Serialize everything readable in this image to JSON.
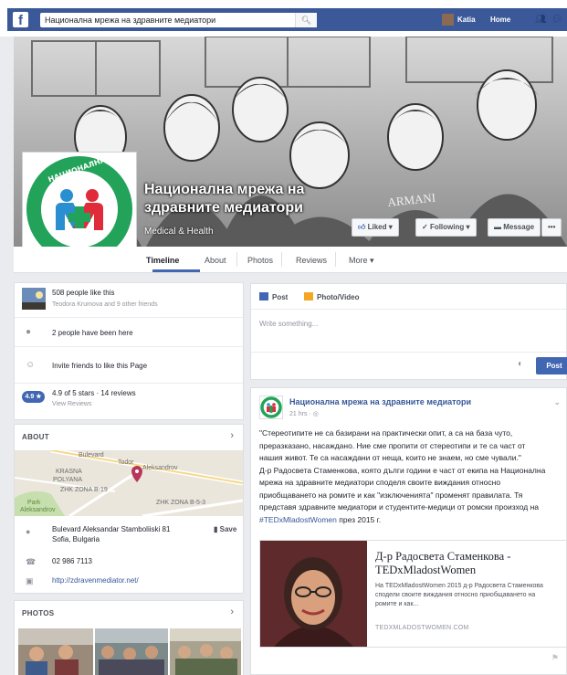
{
  "topbar": {
    "logo": "f",
    "search_value": "Национална мрежа на здравните медиатори",
    "user_name": "Katia",
    "home_label": "Home",
    "icons": [
      "search-icon",
      "friends-icon",
      "messages-icon"
    ]
  },
  "page": {
    "name": "Национална мрежа на здравните медиатори",
    "category": "Medical & Health",
    "buttons": {
      "liked": "Liked ▾",
      "following": "Following ▾",
      "message": "Message",
      "more": "•••"
    }
  },
  "tabs": [
    "Timeline",
    "About",
    "Photos",
    "Reviews",
    "More ▾"
  ],
  "likes_card": {
    "likes": "508 people like this",
    "likes_sub": "Teodora Krumova and 9 other friends",
    "been_here": "2 people have been here",
    "invite": "Invite friends to like this Page",
    "rating_badge": "4.9 ★",
    "rating": "4.9 of 5 stars · 14 reviews",
    "view_reviews": "View Reviews"
  },
  "about": {
    "title": "ABOUT",
    "map_labels": [
      "Bulevard",
      "Todor",
      "Aleksandrov",
      "KRASNA",
      "POLYANA",
      "ZHK ZONA B-19",
      "Park",
      "Aleksandrov",
      "ZHK ZONA B-5-3"
    ],
    "address_line1": "Bulevard Aleksandar Stamboliiski 81",
    "address_line2": "Sofia, Bulgaria",
    "save": "Save",
    "phone": "02 986 7113",
    "website": "http://zdravenmediator.net/"
  },
  "photos": {
    "title": "PHOTOS"
  },
  "composer": {
    "post_tab": "Post",
    "photo_tab": "Photo/Video",
    "placeholder": "Write something...",
    "post_button": "Post"
  },
  "post": {
    "author": "Национална мрежа на здравните медиатори",
    "time": "21 hrs · ",
    "body": [
      "\"Стереотипите не са базирани на практически опит, а са на база чуто,",
      "преразказано, насаждано. Ние сме пропити от стереотипи и те са част от",
      "нашия живот. Те са насаждани от неща, които не знаем, но сме чували.\"",
      "Д-р Радосвета Стаменкова, която дълги години е част от екипа на Национална",
      "мрежа на здравните медиатори споделя своите виждания относно",
      "приобщаването на ромите и как \"изключенията\" променят правилата. Тя",
      "представя здравните медиатори и студентите-медици от ромски произход на"
    ],
    "hashtag": "#TEDxMladostWomen",
    "body_tail": " през 2015 г.",
    "link": {
      "title": "Д-р Радосвета Стаменкова - TEDxMladostWomen",
      "description": "На TEDxMladostWomen 2015 д-р Радосвета Стаменкова сподели своите виждания относно приобщаването на ромите и как...",
      "domain": "TEDXMLADOSTWOMEN.COM"
    }
  }
}
